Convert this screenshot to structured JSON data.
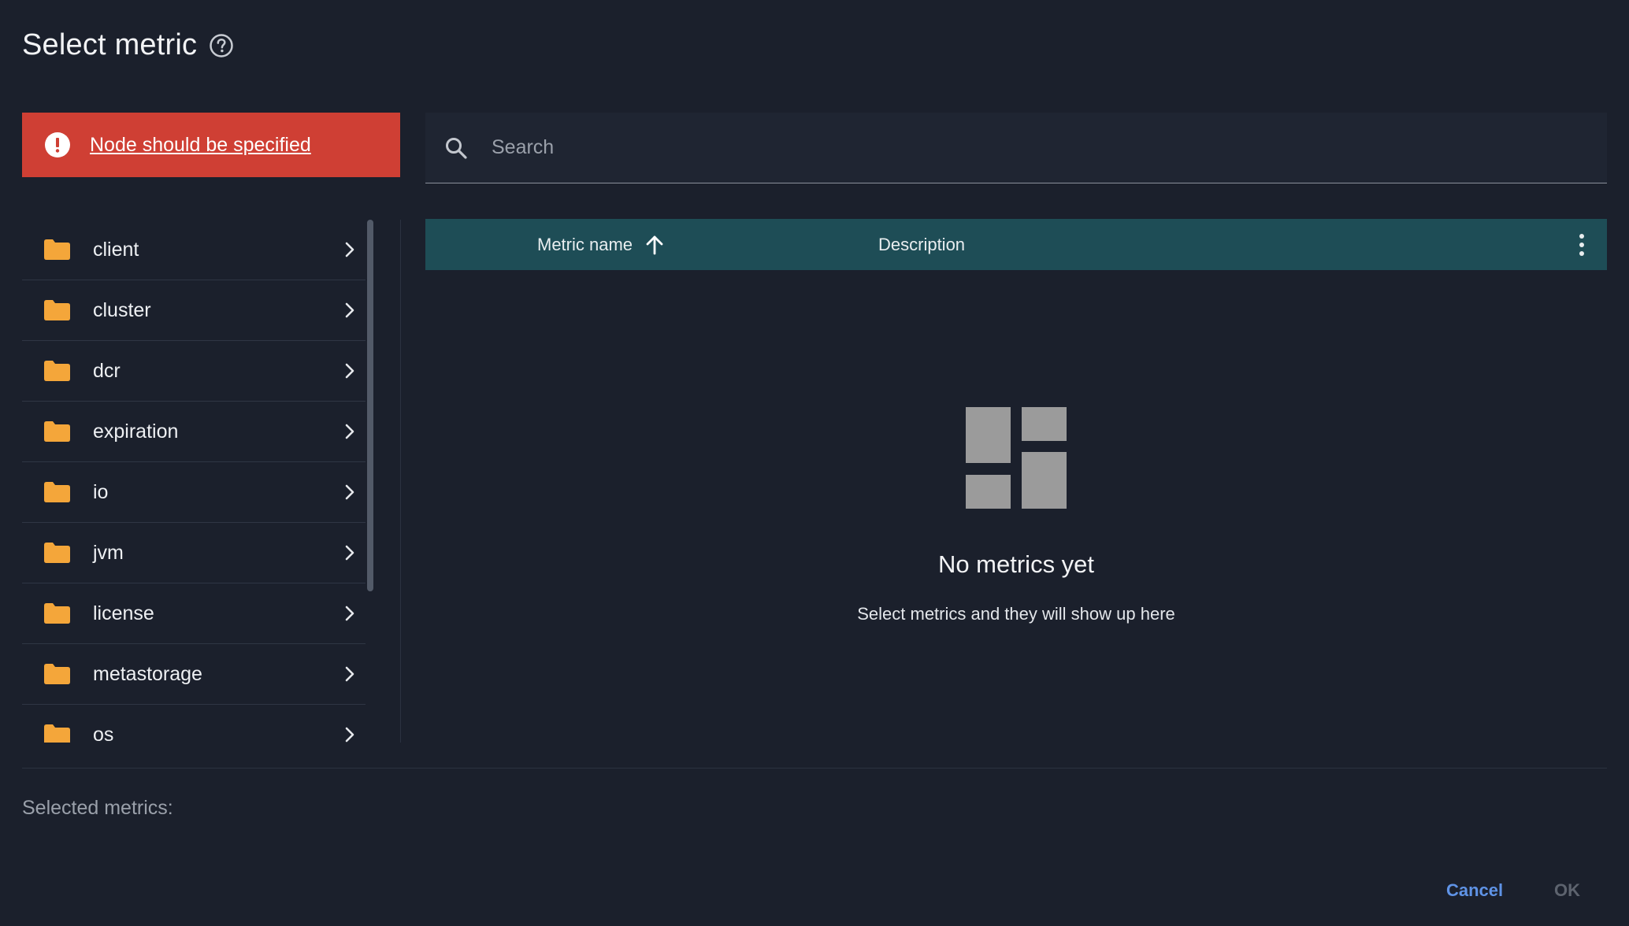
{
  "dialog": {
    "title": "Select metric",
    "help_icon": "question-circle-icon"
  },
  "error": {
    "icon": "exclamation-circle-icon",
    "message": "Node should be specified",
    "color": "#cf3f34"
  },
  "tree": {
    "items": [
      {
        "label": "client"
      },
      {
        "label": "cluster"
      },
      {
        "label": "dcr"
      },
      {
        "label": "expiration"
      },
      {
        "label": "io"
      },
      {
        "label": "jvm"
      },
      {
        "label": "license"
      },
      {
        "label": "metastorage"
      },
      {
        "label": "os"
      }
    ],
    "folder_color": "#f4a63a"
  },
  "search": {
    "placeholder": "Search",
    "value": ""
  },
  "table": {
    "columns": [
      {
        "label": "Metric name",
        "sort": "ascending"
      },
      {
        "label": "Description"
      }
    ],
    "header_color": "#1e4d56"
  },
  "empty_state": {
    "title": "No metrics yet",
    "subtitle": "Select metrics and they will show up here"
  },
  "selected": {
    "label": "Selected metrics:"
  },
  "actions": {
    "cancel": "Cancel",
    "ok": "OK"
  }
}
